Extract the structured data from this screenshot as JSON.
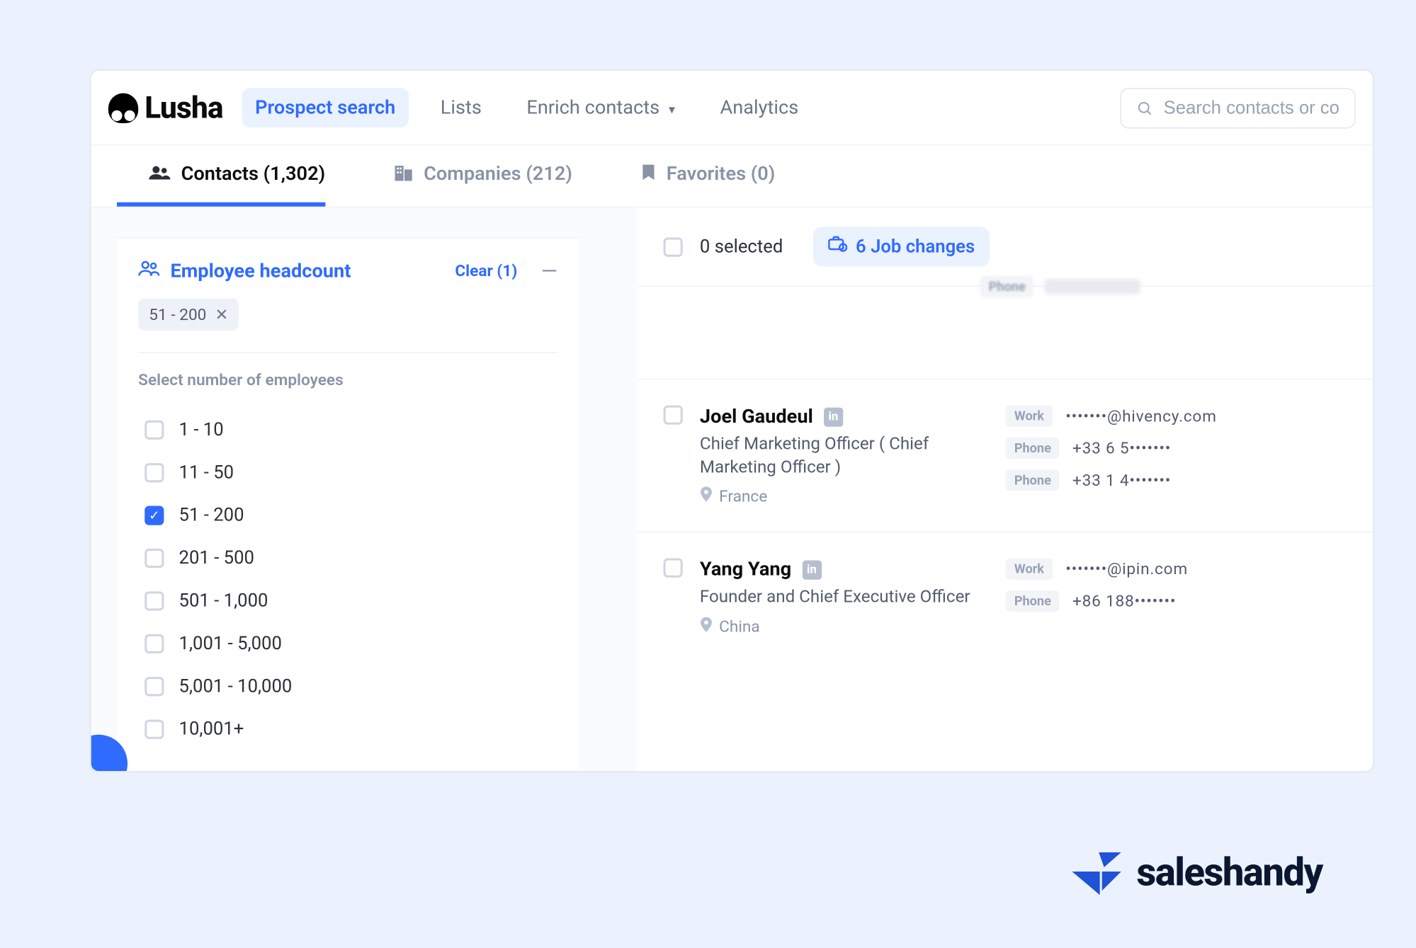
{
  "brand": {
    "name": "Lusha"
  },
  "nav": {
    "prospect": "Prospect search",
    "lists": "Lists",
    "enrich": "Enrich contacts",
    "analytics": "Analytics"
  },
  "search": {
    "placeholder": "Search contacts or co"
  },
  "subtabs": {
    "contacts_label": "Contacts (1,302)",
    "companies_label": "Companies (212)",
    "favorites_label": "Favorites (0)"
  },
  "filters": {
    "headcount": {
      "title": "Employee headcount",
      "clear_label": "Clear (1)",
      "active_chip": "51 - 200",
      "section_label": "Select number of employees",
      "options": [
        {
          "label": "1 - 10",
          "checked": false
        },
        {
          "label": "11 - 50",
          "checked": false
        },
        {
          "label": "51 - 200",
          "checked": true
        },
        {
          "label": "201 - 500",
          "checked": false
        },
        {
          "label": "501 - 1,000",
          "checked": false
        },
        {
          "label": "1,001 - 5,000",
          "checked": false
        },
        {
          "label": "5,001 - 10,000",
          "checked": false
        },
        {
          "label": "10,001+",
          "checked": false
        }
      ]
    }
  },
  "results": {
    "selected_label": "0 selected",
    "job_changes_label": "6 Job changes",
    "blurred_phone_badge": "Phone",
    "rows": [
      {
        "name": "Joel Gaudeul",
        "title": "Chief Marketing Officer ( Chief Marketing Officer )",
        "location": "France",
        "info": [
          {
            "badge": "Work",
            "value": "•••••••@hivency.com"
          },
          {
            "badge": "Phone",
            "value": "+33 6 5•••••••"
          },
          {
            "badge": "Phone",
            "value": "+33 1 4•••••••"
          }
        ]
      },
      {
        "name": "Yang Yang",
        "title": "Founder and Chief Executive Officer",
        "location": "China",
        "info": [
          {
            "badge": "Work",
            "value": "•••••••@ipin.com"
          },
          {
            "badge": "Phone",
            "value": "+86 188•••••••"
          }
        ]
      }
    ]
  },
  "footer": {
    "brand": "saleshandy"
  }
}
